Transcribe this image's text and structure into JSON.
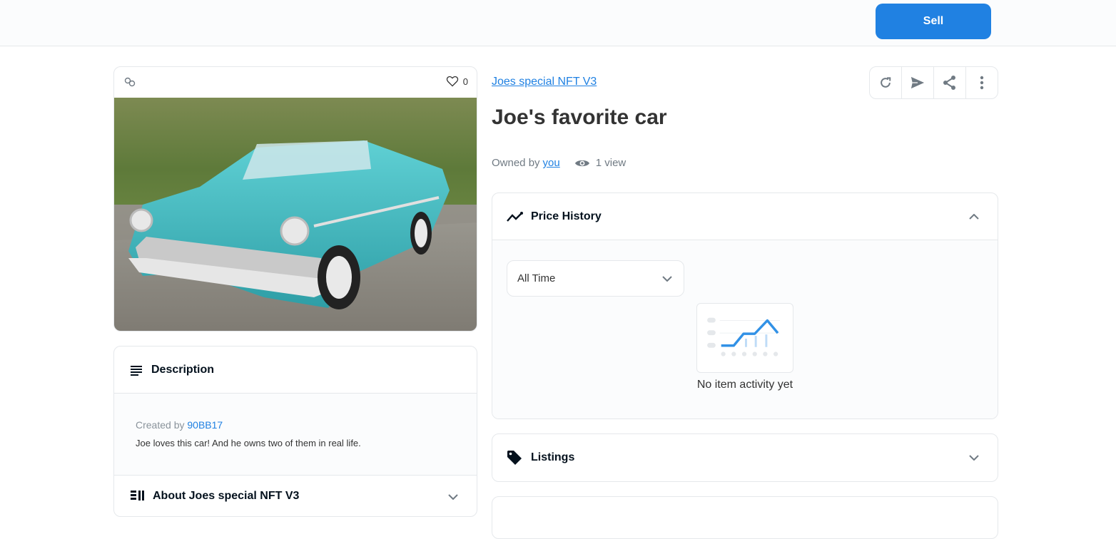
{
  "header": {
    "sell_label": "Sell"
  },
  "media": {
    "favorite_count": "0"
  },
  "description": {
    "title": "Description",
    "created_by_prefix": "Created by",
    "creator": "90BB17",
    "text": "Joe loves this car! And he owns two of them in real life."
  },
  "about": {
    "title": "About Joes special NFT V3"
  },
  "item": {
    "collection": "Joes special NFT V3",
    "title": "Joe's favorite car",
    "owned_by_prefix": "Owned by",
    "owner": "you",
    "views": "1 view"
  },
  "actions": [
    "refresh-icon",
    "transfer-icon",
    "share-icon",
    "more-icon"
  ],
  "price_history": {
    "title": "Price History",
    "period": "All Time",
    "empty_text": "No item activity yet"
  },
  "listings": {
    "title": "Listings"
  },
  "colors": {
    "accent": "#2081e2",
    "border": "#e5e8eb",
    "car": "#3fb8c0"
  }
}
